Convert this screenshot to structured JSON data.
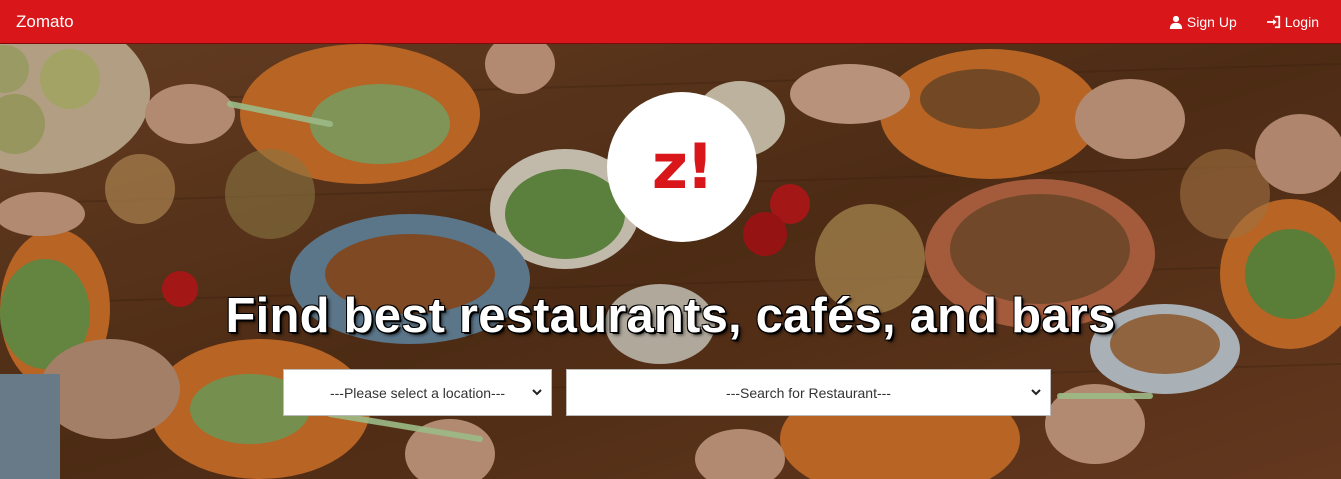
{
  "navbar": {
    "brand": "Zomato",
    "sign_up": "Sign Up",
    "login": "Login",
    "bg_color": "#d9171a"
  },
  "hero": {
    "logo_text": "z!",
    "headline": "Find best restaurants, cafés, and bars",
    "location_select": {
      "selected": "---Please select a location---"
    },
    "restaurant_select": {
      "selected": "---Search for Restaurant---"
    }
  },
  "icons": {
    "sign_up": "user-icon",
    "login": "login-icon",
    "dropdown": "chevron-down-icon"
  }
}
